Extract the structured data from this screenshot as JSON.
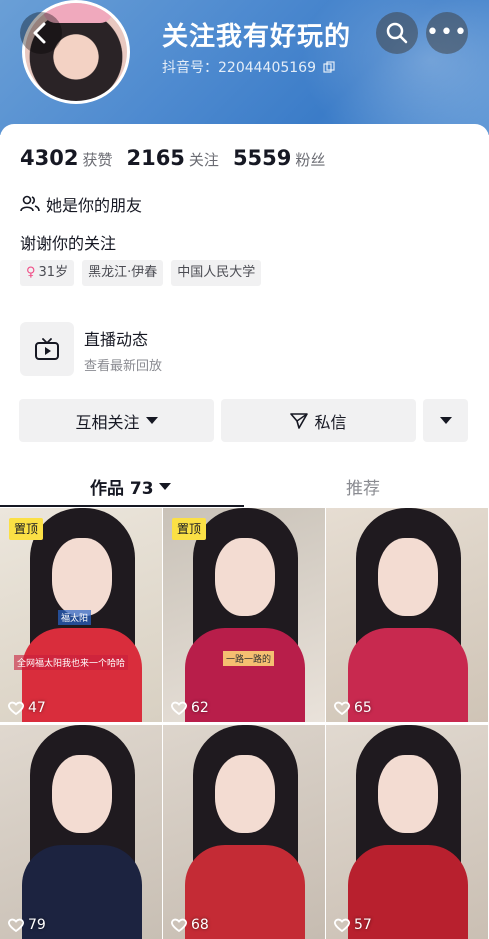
{
  "header": {
    "nickname": "关注我有好玩的",
    "douyin_id": "抖音号：22044405169",
    "back_icon": "chevron-left-icon",
    "search_icon": "search-icon",
    "more_icon": "more-dots-icon"
  },
  "stats": [
    {
      "value": "4302",
      "label": "获赞"
    },
    {
      "value": "2165",
      "label": "关注"
    },
    {
      "value": "5559",
      "label": "粉丝"
    }
  ],
  "profile": {
    "friend_text": "她是你的朋友",
    "bio": "谢谢你的关注",
    "tags": [
      {
        "text": "31岁",
        "icon": "female-icon"
      },
      {
        "text": "黑龙江·伊春"
      },
      {
        "text": "中国人民大学"
      }
    ]
  },
  "live": {
    "title": "直播动态",
    "subtitle": "查看最新回放",
    "icon": "tv-icon"
  },
  "actions": {
    "follow_label": "互相关注",
    "message_label": "私信"
  },
  "tabs": {
    "works_label": "作品 73",
    "recommend_label": "推荐"
  },
  "videos": [
    {
      "likes": "47",
      "pinned": "置顶",
      "caption": "全网福太阳我也来一个哈哈",
      "subcaption": "福太阳"
    },
    {
      "likes": "62",
      "pinned": "置顶",
      "caption": "一路一路的"
    },
    {
      "likes": "65"
    },
    {
      "likes": "79"
    },
    {
      "likes": "68"
    },
    {
      "likes": "57"
    }
  ],
  "colors": {
    "header_blue": "#4f8bd0",
    "pin_yellow": "#fbe045",
    "female_pink": "#f04d86"
  }
}
